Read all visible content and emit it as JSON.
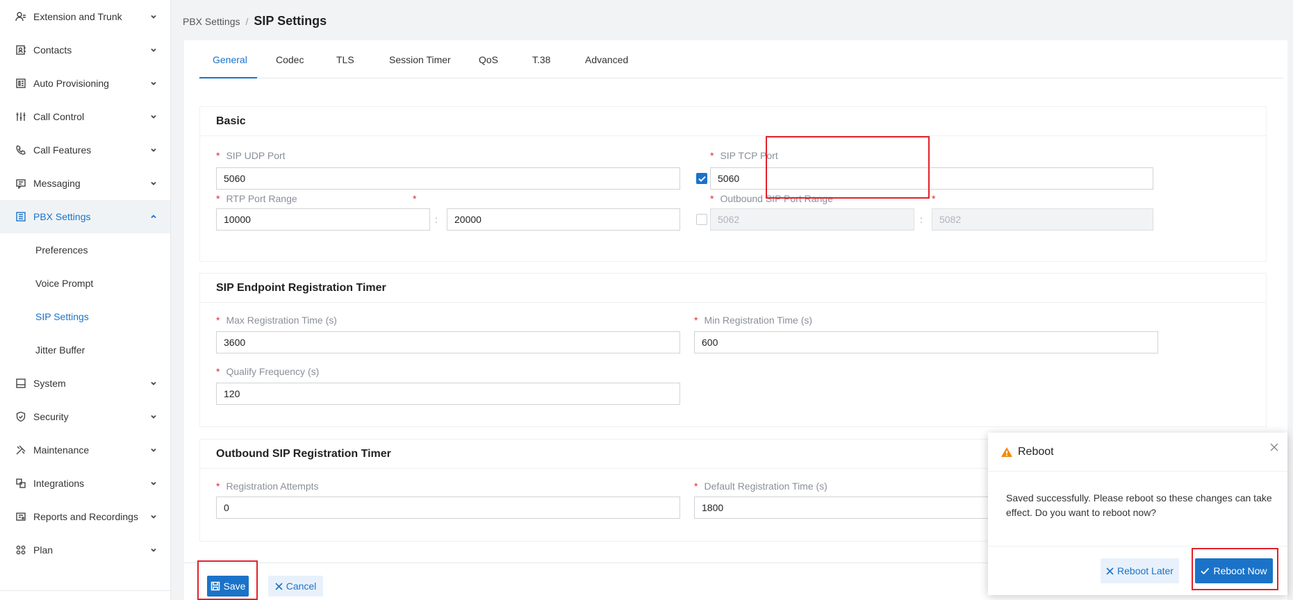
{
  "sidebar": {
    "items": [
      {
        "label": "Extension and Trunk",
        "icon": "user-icon"
      },
      {
        "label": "Contacts",
        "icon": "contacts-icon"
      },
      {
        "label": "Auto Provisioning",
        "icon": "provisioning-icon"
      },
      {
        "label": "Call Control",
        "icon": "sliders-icon"
      },
      {
        "label": "Call Features",
        "icon": "phone-icon"
      },
      {
        "label": "Messaging",
        "icon": "message-icon"
      },
      {
        "label": "PBX Settings",
        "icon": "settings-grid-icon"
      },
      {
        "label": "System",
        "icon": "system-icon"
      },
      {
        "label": "Security",
        "icon": "shield-icon"
      },
      {
        "label": "Maintenance",
        "icon": "tools-icon"
      },
      {
        "label": "Integrations",
        "icon": "integrations-icon"
      },
      {
        "label": "Reports and Recordings",
        "icon": "reports-icon"
      },
      {
        "label": "Plan",
        "icon": "plan-icon"
      }
    ],
    "pbx_sub": [
      "Preferences",
      "Voice Prompt",
      "SIP Settings",
      "Jitter Buffer"
    ]
  },
  "breadcrumb": {
    "parent": "PBX Settings",
    "separator": "/",
    "current": "SIP Settings"
  },
  "tabs": [
    "General",
    "Codec",
    "TLS",
    "Session Timer",
    "QoS",
    "T.38",
    "Advanced"
  ],
  "basic": {
    "title": "Basic",
    "udp_label": "SIP UDP Port",
    "udp_value": "5060",
    "tcp_label": "SIP TCP Port",
    "tcp_value": "5060",
    "rtp_label": "RTP Port Range",
    "rtp_start": "10000",
    "rtp_end": "20000",
    "outbound_label": "Outbound SIP Port Range",
    "outbound_start": "5062",
    "outbound_end": "5082",
    "required_mark": "*",
    "range_sep": ":"
  },
  "endpoint": {
    "title": "SIP Endpoint Registration Timer",
    "max_label": "Max Registration Time (s)",
    "max_value": "3600",
    "min_label": "Min Registration Time (s)",
    "min_value": "600",
    "qualify_label": "Qualify Frequency (s)",
    "qualify_value": "120"
  },
  "outbound_timer": {
    "title": "Outbound SIP Registration Timer",
    "attempts_label": "Registration Attempts",
    "attempts_value": "0",
    "default_label": "Default Registration Time (s)",
    "default_value": "1800"
  },
  "footer": {
    "save": "Save",
    "cancel": "Cancel"
  },
  "dialog": {
    "title": "Reboot",
    "message": "Saved successfully. Please reboot so these changes can take effect. Do you want to reboot now?",
    "later": "Reboot Later",
    "now": "Reboot Now"
  },
  "colors": {
    "accent": "#1a73c8",
    "highlight": "#e4202a",
    "warning": "#f08a12"
  }
}
